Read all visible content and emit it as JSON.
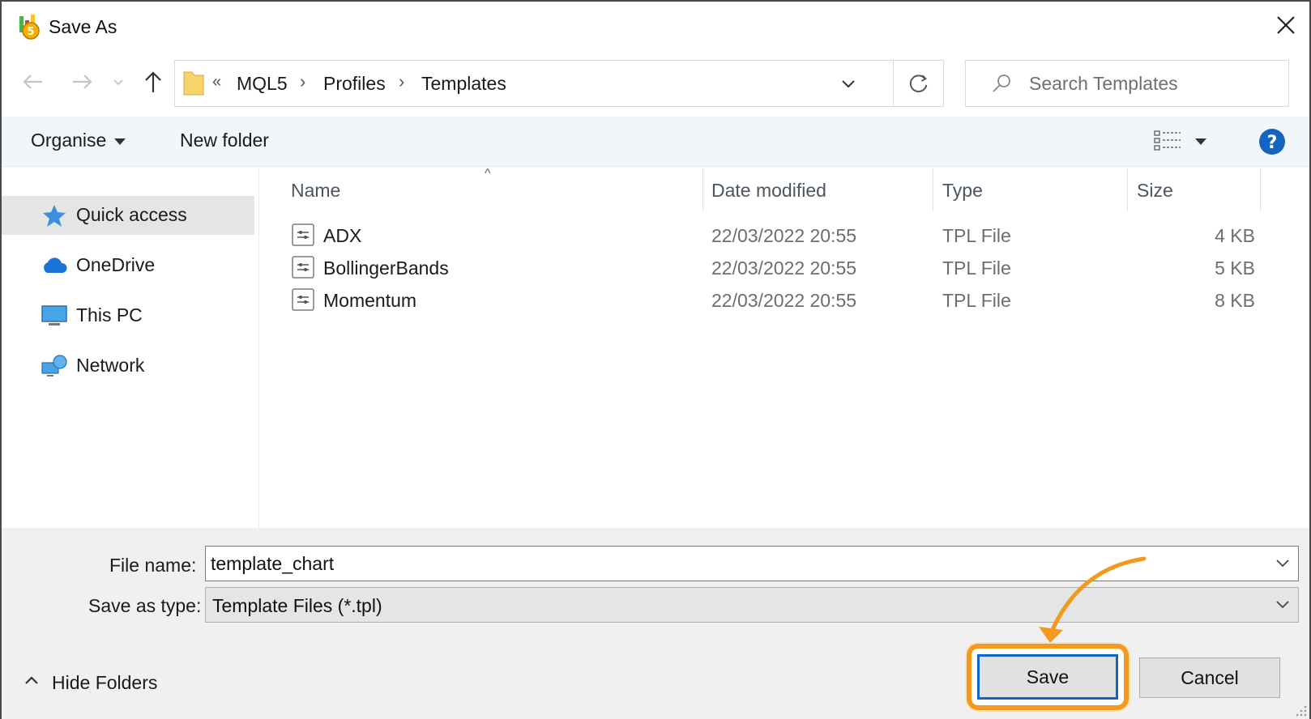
{
  "window": {
    "title": "Save As"
  },
  "address": {
    "overflow": "«",
    "crumbs": [
      "MQL5",
      "Profiles",
      "Templates"
    ]
  },
  "search": {
    "placeholder": "Search Templates"
  },
  "toolbar": {
    "organise": "Organise",
    "new_folder": "New folder"
  },
  "sidebar": {
    "items": [
      {
        "label": "Quick access",
        "icon": "star-pin-icon",
        "selected": true
      },
      {
        "label": "OneDrive",
        "icon": "cloud-icon"
      },
      {
        "label": "This PC",
        "icon": "monitor-icon"
      },
      {
        "label": "Network",
        "icon": "network-icon"
      }
    ]
  },
  "files": {
    "columns": [
      "Name",
      "Date modified",
      "Type",
      "Size"
    ],
    "rows": [
      {
        "name": "ADX",
        "date": "22/03/2022 20:55",
        "type": "TPL File",
        "size": "4 KB"
      },
      {
        "name": "BollingerBands",
        "date": "22/03/2022 20:55",
        "type": "TPL File",
        "size": "5 KB"
      },
      {
        "name": "Momentum",
        "date": "22/03/2022 20:55",
        "type": "TPL File",
        "size": "8 KB"
      }
    ]
  },
  "form": {
    "file_name_label": "File name:",
    "file_name_value": "template_chart",
    "save_type_label": "Save as type:",
    "save_type_value": "Template Files (*.tpl)"
  },
  "footer": {
    "hide_folders": "Hide Folders",
    "save": "Save",
    "cancel": "Cancel"
  },
  "colors": {
    "accent": "#0f66c8",
    "highlight": "#f39a1e",
    "help": "#1565c0"
  }
}
